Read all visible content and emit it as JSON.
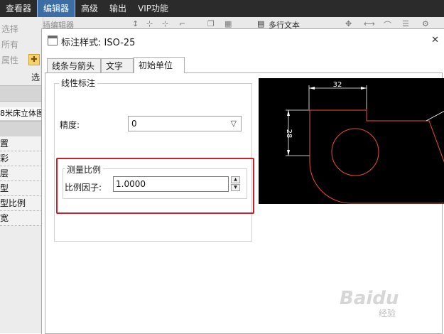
{
  "menubar": {
    "items": [
      "查看器",
      "编辑器",
      "高级",
      "输出",
      "VIP功能"
    ],
    "active_index": 1
  },
  "toolbar": {
    "partial_labels": [
      "插编辑器",
      "多行文本"
    ]
  },
  "left_panel": {
    "labels": [
      "选择",
      "所有",
      "属性",
      "选"
    ],
    "title": "8米床立体图",
    "rows": [
      "置",
      "彩",
      "层",
      "型",
      "型比例",
      "宽"
    ]
  },
  "dialog": {
    "title": "标注样式: ISO-25",
    "close_glyph": "✕",
    "tabs": [
      "线条与箭头",
      "文字",
      "初始单位"
    ],
    "active_tab": 2,
    "linear": {
      "group_label": "线性标注",
      "precision_label": "精度:",
      "precision_value": "0"
    },
    "scale": {
      "group_label": "测量比例",
      "factor_label": "比例因子:",
      "factor_value": "1.0000"
    },
    "preview": {
      "dim_horizontal": "32",
      "dim_vertical": "28",
      "colors": {
        "dimension": "#ffffff",
        "geometry": "#e8503c",
        "background": "#000000"
      }
    }
  },
  "highlight_color": "#c4222c",
  "watermark": {
    "text": "Baidu",
    "sub": "经验"
  }
}
